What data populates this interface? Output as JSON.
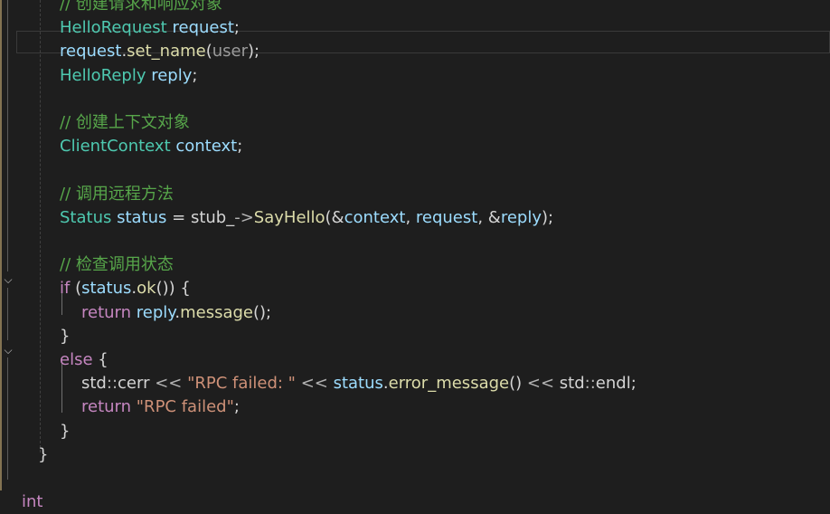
{
  "editor": {
    "lines": [
      {
        "tokens": [
          {
            "t": "// 创建请求和响应对象",
            "c": "cm"
          }
        ]
      },
      {
        "tokens": [
          {
            "t": "HelloRequest",
            "c": "type"
          },
          {
            "t": " ",
            "c": "p"
          },
          {
            "t": "request",
            "c": "var"
          },
          {
            "t": ";",
            "c": "p"
          }
        ]
      },
      {
        "tokens": [
          {
            "t": "request",
            "c": "var"
          },
          {
            "t": ".",
            "c": "p"
          },
          {
            "t": "set_name",
            "c": "fn"
          },
          {
            "t": "(",
            "c": "p"
          },
          {
            "t": "user",
            "c": "gray"
          },
          {
            "t": ");",
            "c": "p"
          }
        ]
      },
      {
        "tokens": [
          {
            "t": "HelloReply",
            "c": "type"
          },
          {
            "t": " ",
            "c": "p"
          },
          {
            "t": "reply",
            "c": "var"
          },
          {
            "t": ";",
            "c": "p"
          }
        ]
      },
      {
        "tokens": []
      },
      {
        "tokens": [
          {
            "t": "// 创建上下文对象",
            "c": "cm"
          }
        ]
      },
      {
        "tokens": [
          {
            "t": "ClientContext",
            "c": "type"
          },
          {
            "t": " ",
            "c": "p"
          },
          {
            "t": "context",
            "c": "var"
          },
          {
            "t": ";",
            "c": "p"
          }
        ]
      },
      {
        "tokens": []
      },
      {
        "tokens": [
          {
            "t": "// 调用远程方法",
            "c": "cm"
          }
        ]
      },
      {
        "tokens": [
          {
            "t": "Status",
            "c": "type"
          },
          {
            "t": " ",
            "c": "p"
          },
          {
            "t": "status",
            "c": "var"
          },
          {
            "t": " = ",
            "c": "p"
          },
          {
            "t": "stub_",
            "c": "p"
          },
          {
            "t": "->",
            "c": "op"
          },
          {
            "t": "SayHello",
            "c": "fn"
          },
          {
            "t": "(&",
            "c": "p"
          },
          {
            "t": "context",
            "c": "var"
          },
          {
            "t": ", ",
            "c": "p"
          },
          {
            "t": "request",
            "c": "var"
          },
          {
            "t": ", &",
            "c": "p"
          },
          {
            "t": "reply",
            "c": "var"
          },
          {
            "t": ");",
            "c": "p"
          }
        ]
      },
      {
        "tokens": []
      },
      {
        "tokens": [
          {
            "t": "// 检查调用状态",
            "c": "cm"
          }
        ]
      },
      {
        "tokens": [
          {
            "t": "if",
            "c": "kw"
          },
          {
            "t": " (",
            "c": "p"
          },
          {
            "t": "status",
            "c": "var"
          },
          {
            "t": ".",
            "c": "p"
          },
          {
            "t": "ok",
            "c": "fn"
          },
          {
            "t": "()) {",
            "c": "p"
          }
        ]
      },
      {
        "tokens": [
          {
            "t": "return",
            "c": "kw"
          },
          {
            "t": " ",
            "c": "p"
          },
          {
            "t": "reply",
            "c": "var"
          },
          {
            "t": ".",
            "c": "p"
          },
          {
            "t": "message",
            "c": "fn"
          },
          {
            "t": "();",
            "c": "p"
          }
        ]
      },
      {
        "tokens": [
          {
            "t": "}",
            "c": "p"
          }
        ]
      },
      {
        "tokens": [
          {
            "t": "else",
            "c": "kw"
          },
          {
            "t": " {",
            "c": "p"
          }
        ]
      },
      {
        "tokens": [
          {
            "t": "std",
            "c": "p"
          },
          {
            "t": "::",
            "c": "op"
          },
          {
            "t": "cerr",
            "c": "p"
          },
          {
            "t": " << ",
            "c": "op"
          },
          {
            "t": "\"RPC failed: \"",
            "c": "str"
          },
          {
            "t": " << ",
            "c": "op"
          },
          {
            "t": "status",
            "c": "var"
          },
          {
            "t": ".",
            "c": "p"
          },
          {
            "t": "error_message",
            "c": "fn"
          },
          {
            "t": "()",
            "c": "p"
          },
          {
            "t": " << ",
            "c": "op"
          },
          {
            "t": "std",
            "c": "p"
          },
          {
            "t": "::",
            "c": "op"
          },
          {
            "t": "endl",
            "c": "p"
          },
          {
            "t": ";",
            "c": "p"
          }
        ]
      },
      {
        "tokens": [
          {
            "t": "return",
            "c": "kw"
          },
          {
            "t": " ",
            "c": "p"
          },
          {
            "t": "\"RPC failed\"",
            "c": "str"
          },
          {
            "t": ";",
            "c": "p"
          }
        ]
      },
      {
        "tokens": [
          {
            "t": "}",
            "c": "p"
          }
        ]
      },
      {
        "tokens": [
          {
            "t": "}",
            "c": "p"
          }
        ]
      },
      {
        "tokens": []
      },
      {
        "tokens": [
          {
            "t": "int",
            "c": "kw"
          }
        ]
      }
    ]
  },
  "colors": {
    "background": "#1e1e1e",
    "type": "#4ec9b0",
    "variable": "#9cdcfe",
    "function": "#dcdcaa",
    "keyword": "#c586c0",
    "string": "#ce9178",
    "comment": "#57a64a"
  },
  "icons": [
    "fold-chevron-icon"
  ]
}
